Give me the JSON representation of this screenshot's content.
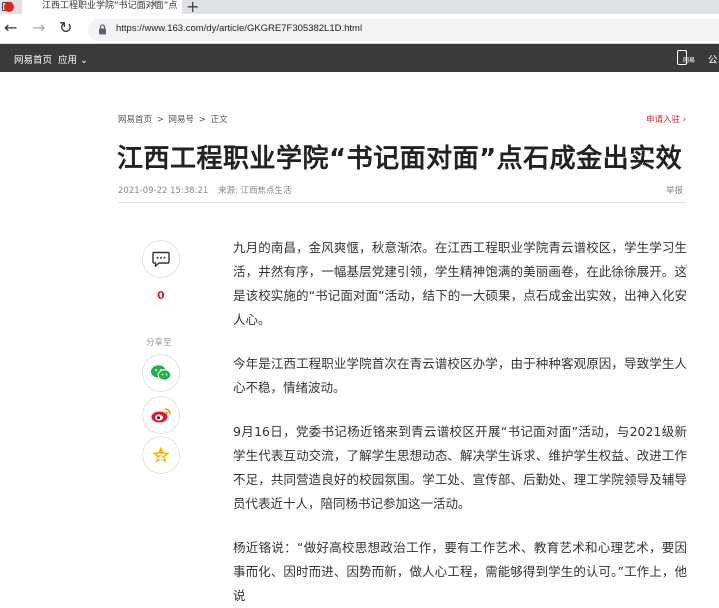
{
  "browser": {
    "tab_title": "江西工程职业学院“书记面对面”点",
    "tab_close": "×",
    "new_tab": "+",
    "back": "←",
    "forward": "→",
    "reload": "↻",
    "url": "https://www.163.com/dy/article/GKGRE7F305382L1D.html"
  },
  "site_nav": {
    "home": "网易首页",
    "apps": "应用 ⌄",
    "app_label": "网易",
    "right": "公"
  },
  "article": {
    "breadcrumb": [
      "网易首页",
      ">",
      "网易号",
      ">",
      "正文"
    ],
    "register_link": "申请入驻 ›",
    "title": "江西工程职业学院“书记面对面”点石成金出实效",
    "date": "2021-09-22 15:38:21",
    "source": "来源: 江西焦点生活",
    "report": "举报",
    "comment_count": "0",
    "share_label": "分享至",
    "paragraphs": [
      "九月的南昌，金风爽惬，秋意渐浓。在江西工程职业学院青云谱校区，学生学习生活，井然有序，一幅基层党建引领，学生精神饱满的美丽画卷，在此徐徐展开。这是该校实施的“书记面对面”活动，结下的一大硕果，点石成金出实效，出神入化安人心。",
      "今年是江西工程职业学院首次在青云谱校区办学，由于种种客观原因，导致学生人心不稳，情绪波动。",
      "9月16日，党委书记杨近铬来到青云谱校区开展“书记面对面”活动，与2021级新学生代表互动交流，了解学生思想动态、解决学生诉求、维护学生权益、改进工作不足，共同营造良好的校园氛围。学工处、宣传部、后勤处、理工学院领导及辅导员代表近十人，陪同杨书记参加这一活动。",
      "杨近铬说：“做好高校思想政治工作，要有工作艺术、教育艺术和心理艺术，要因事而化、因时而进、因势而新，做人心工程，需能够得到学生的认可。”工作上，他说"
    ]
  },
  "icons": {
    "comment": "comment-icon",
    "wechat": "wechat-icon",
    "weibo": "weibo-icon",
    "qzone": "qzone-icon"
  },
  "colors": {
    "accent_red": "#e0262b",
    "nav_bg": "#3a3a3a"
  }
}
